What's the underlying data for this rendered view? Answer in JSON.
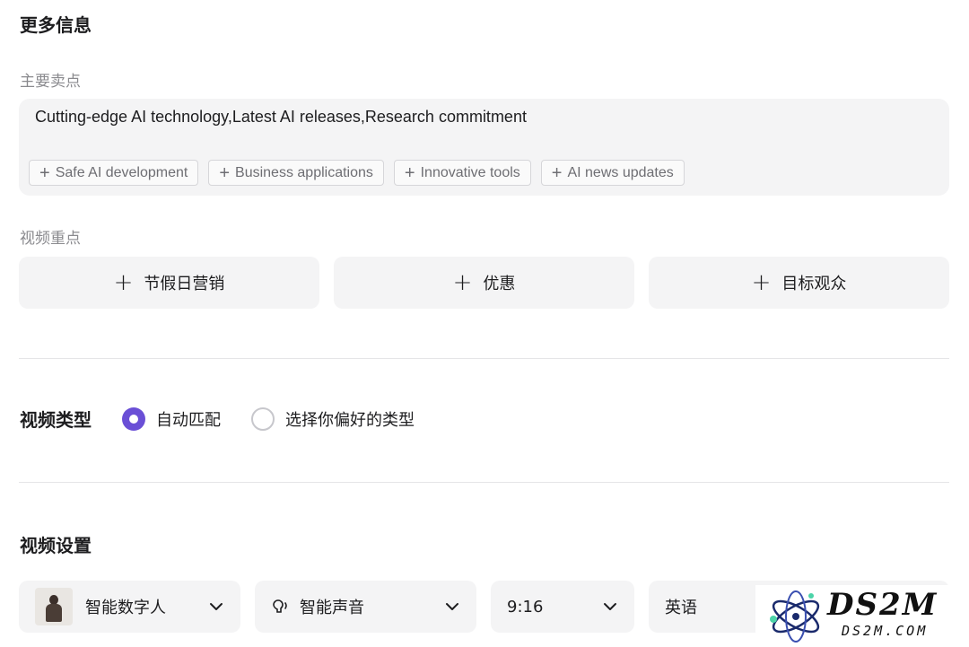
{
  "more_info": {
    "title": "更多信息",
    "selling_points_label": "主要卖点",
    "selling_points_value": "Cutting-edge AI technology,Latest AI releases,Research commitment",
    "chips": [
      {
        "label": "Safe AI development"
      },
      {
        "label": "Business applications"
      },
      {
        "label": "Innovative tools"
      },
      {
        "label": "AI news updates"
      }
    ],
    "video_focus_label": "视频重点",
    "focus_buttons": [
      {
        "label": "节假日营销"
      },
      {
        "label": "优惠"
      },
      {
        "label": "目标观众"
      }
    ]
  },
  "video_type": {
    "label": "视频类型",
    "options": [
      {
        "label": "自动匹配",
        "checked": true
      },
      {
        "label": "选择你偏好的类型",
        "checked": false
      }
    ]
  },
  "video_settings": {
    "title": "视频设置",
    "avatar_label": "智能数字人",
    "voice_label": "智能声音",
    "ratio_label": "9:16",
    "language_label": "英语"
  },
  "watermark": {
    "brand": "DS2M",
    "domain": "DS2M.COM"
  },
  "colors": {
    "accent": "#6a4fd6",
    "field_bg": "#f4f4f5"
  }
}
